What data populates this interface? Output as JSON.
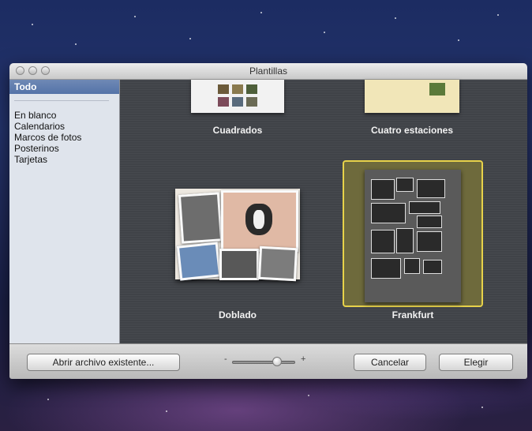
{
  "window": {
    "title": "Plantillas"
  },
  "sidebar": {
    "selected": "Todo",
    "items": [
      "En blanco",
      "Calendarios",
      "Marcos de fotos",
      "Posterinos",
      "Tarjetas"
    ]
  },
  "templates": [
    {
      "label": "Cuadrados"
    },
    {
      "label": "Cuatro estaciones"
    },
    {
      "label": "Doblado"
    },
    {
      "label": "Frankfurt",
      "selected": true
    }
  ],
  "footer": {
    "open_label": "Abrir archivo existente...",
    "zoom_minus": "-",
    "zoom_plus": "+",
    "cancel_label": "Cancelar",
    "choose_label": "Elegir"
  },
  "colors": {
    "selection_border": "#e7d24a",
    "sidebar_selected": "#5f7aac"
  }
}
